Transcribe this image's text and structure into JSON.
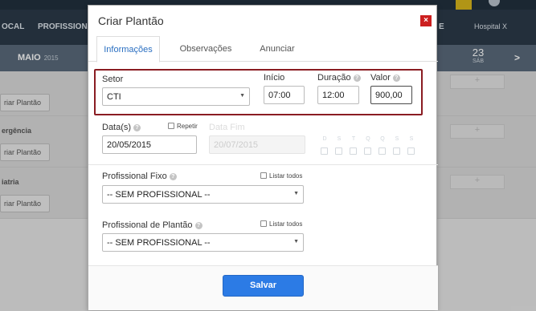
{
  "background": {
    "nav_items": [
      "OCAL",
      "PROFISSIONAL",
      "E",
      "Hospital X"
    ],
    "month": "MAIO",
    "year": "2015",
    "day_number": "23",
    "day_name": "SÁB",
    "next_arrow": ">",
    "sections": [
      "ergência",
      "iatria"
    ],
    "add_shift_label": "riar Plantão",
    "plus": "+"
  },
  "modal": {
    "title": "Criar Plantão",
    "close": "×",
    "tabs": [
      "Informações",
      "Observações",
      "Anunciar"
    ],
    "setor": {
      "label": "Setor",
      "value": "CTI"
    },
    "inicio": {
      "label": "Início",
      "value": "07:00"
    },
    "duracao": {
      "label": "Duração",
      "value": "12:00"
    },
    "valor": {
      "label": "Valor",
      "value": "900,00"
    },
    "datas": {
      "label": "Data(s)",
      "value": "20/05/2015"
    },
    "repetir": "Repetir",
    "data_fim": {
      "label": "Data Fim",
      "value": "20/07/2015"
    },
    "weekdays": [
      "D",
      "S",
      "T",
      "Q",
      "Q",
      "S",
      "S"
    ],
    "profissional_fixo": {
      "label": "Profissional Fixo",
      "value": "-- SEM PROFISSIONAL --"
    },
    "profissional_plantao": {
      "label": "Profissional de Plantão",
      "value": "-- SEM PROFISSIONAL --"
    },
    "listar_todos": "Listar todos",
    "help": "?",
    "caret": "▼",
    "save": "Salvar"
  }
}
